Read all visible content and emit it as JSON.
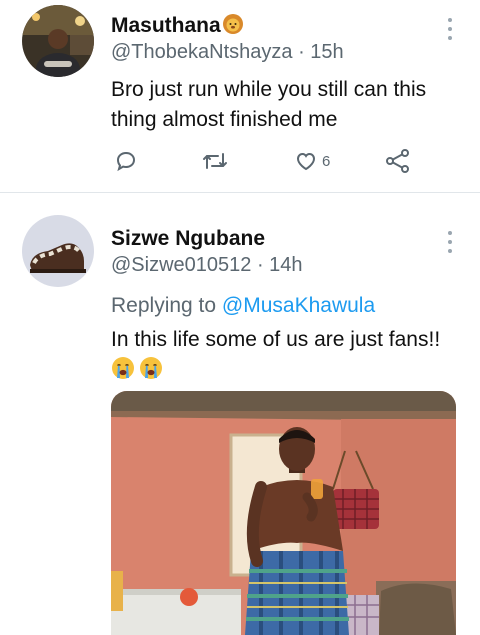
{
  "tweet1": {
    "display_name": "Masuthana",
    "handle": "@ThobekaNtshayza",
    "time": "15h",
    "text_line1": "Bro just run while you still can this",
    "text_line2": "thing almost finished me",
    "like_count": "6",
    "icons": [
      "reply-icon",
      "retweet-icon",
      "like-icon",
      "share-icon",
      "more-icon"
    ]
  },
  "tweet2": {
    "display_name": "Sizwe Ngubane",
    "handle": "@Sizwe010512",
    "time": "14h",
    "replying_prefix": "Replying to",
    "replying_to": "@MusaKhawula",
    "text": "In this life some of us are just fans!!",
    "emoji": [
      "crying-face",
      "crying-face"
    ]
  },
  "colors": {
    "link": "#1d9bf0",
    "secondary_text": "#5b6770",
    "divider": "#e1e6ea"
  }
}
